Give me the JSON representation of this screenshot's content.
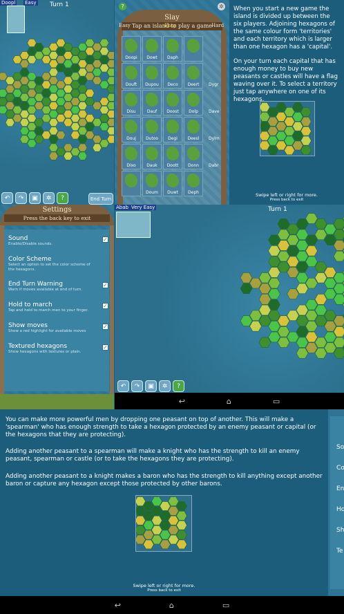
{
  "map_top_left": {
    "tag": "Doopl",
    "difficulty": "Easy",
    "turn": "Turn 1",
    "end_turn_label": "End Turn",
    "toolbar_icons": [
      "undo-icon",
      "redo-icon",
      "save-icon",
      "settings-icon",
      "help-icon"
    ]
  },
  "slay_menu": {
    "title": "Slay",
    "subtitle": "Tap an island to play a game",
    "difficulty_left": "Easy",
    "difficulty_center": "Easy",
    "difficulty_right": "Hard",
    "islands": [
      "Doopi",
      "Dowt",
      "Daph",
      "",
      "Douft",
      "Dupou",
      "Deco",
      "Deert",
      "Disu",
      "Dauf",
      "Doost",
      "Dolp",
      "Douj",
      "Dutoo",
      "Degi",
      "Deesl",
      "Dixo",
      "Dauk",
      "Doott",
      "Donn",
      "",
      "Doum",
      "Duwt",
      "Deph"
    ],
    "islands_right_col": [
      "Dygr",
      "Dave",
      "Dylm",
      "Dabr"
    ]
  },
  "help_top": {
    "p1": "When you start a new game the island is divided up between the six players. Adjoining hexagons of the same colour form 'territories' and each territory which is larger than one hexagon has a 'capital'.",
    "p2": "On your turn each capital that has enough money to buy new peasants or castles will have a flag waving over it. To select a territory just tap anywhere on one of its hexagons.",
    "swipe": "Swipe left or right for more.",
    "back": "Press back to exit"
  },
  "settings": {
    "title": "Settings",
    "subtitle": "Press the back key to exit",
    "items": [
      {
        "title": "Sound",
        "desc": "Enable/Disable sounds.",
        "checked": true
      },
      {
        "title": "Color Scheme",
        "desc": "Select an option to set the color scheme of the hexagons.",
        "checked": false
      },
      {
        "title": "End Turn Warning",
        "desc": "Warn if moves available at end of turn.",
        "checked": true
      },
      {
        "title": "Hold to march",
        "desc": "Tap and hold to march men to your finger.",
        "checked": true
      },
      {
        "title": "Show moves",
        "desc": "Show a red highlight for available moves",
        "checked": true
      },
      {
        "title": "Textured hexagons",
        "desc": "Show hexagons with textures or plain.",
        "checked": true
      }
    ]
  },
  "map_center": {
    "tag": "Abab",
    "difficulty": "Very Easy",
    "turn": "Turn 1"
  },
  "help_bottom": {
    "p1": "You can make more powerful men by dropping one peasant on top of another. This will make a 'spearman' who has enough strength to take a hexagon protected by an enemy peasant or capital (or the hexagons that they are protecting).",
    "p2": "Adding another peasant to a spearman will make a knight who has the strength to kill an enemy peasant, spearman or castle (or to take the hexagons they are protecting).",
    "p3": "Adding another peasant to a knight makes a baron who has the strength to kill anything except another baron or capture any hexagon except those protected by other barons.",
    "swipe": "Swipe left or right for more.",
    "back": "Press back to exit"
  },
  "settings_peek": [
    "So",
    "Co",
    "En",
    "Ho",
    "Sh",
    "Te"
  ],
  "nav": {
    "back": "↩",
    "home": "⌂",
    "recent": "▭"
  },
  "colors": {
    "water": "#2b6f8c",
    "bg": "#1b5d7a",
    "frame": "#7a6040",
    "green": "#4ca845"
  }
}
